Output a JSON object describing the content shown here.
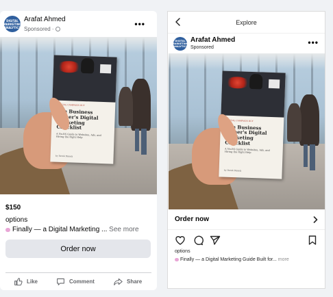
{
  "facebook": {
    "avatar_text": [
      "DIGITAL",
      "MARKETING",
      "ANALYTICS"
    ],
    "page_name": "Arafat Ahmed",
    "sponsored": "Sponsored ·",
    "more": "•••",
    "price": "$150",
    "options": "options",
    "caption": "Finally — a Digital Marketing ...",
    "see_more": "See more",
    "order_button": "Order now",
    "actions": [
      {
        "label": "Like",
        "icon": "thumbs-up-icon"
      },
      {
        "label": "Comment",
        "icon": "comment-icon"
      },
      {
        "label": "Share",
        "icon": "share-icon"
      }
    ]
  },
  "instagram": {
    "header_title": "Explore",
    "page_name": "Arafat Ahmed",
    "sponsored": "Sponsored",
    "more": "•••",
    "order_row": "Order now",
    "options": "options",
    "caption": "Finally — a Digital Marketing Guide Built for...",
    "more_link": "more",
    "action_icons": [
      "heart-icon",
      "comment-icon",
      "send-icon",
      "bookmark-icon"
    ]
  },
  "ad_image": {
    "book_kicker": "SPECIAL CAMPAIGN BUY",
    "book_title": "The Business Owner's Digital Marketing Checklist",
    "book_subtitle": "A No-BS Guide to Websites, Ads, and Hiring the Right Help",
    "book_author": "by Derek Bissett"
  },
  "colors": {
    "page_bg": "#f0f2f5",
    "card_bg": "#ffffff",
    "fb_button_bg": "#e4e6eb",
    "muted_text": "#65676b",
    "avatar_bg": "#2f5f9e"
  }
}
